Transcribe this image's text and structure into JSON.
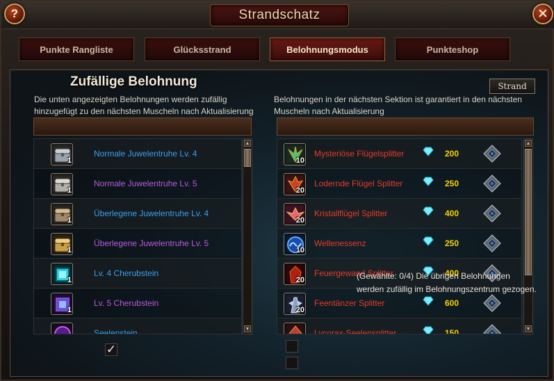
{
  "window": {
    "title": "Strandschatz",
    "help_label": "?",
    "close_label": "✕"
  },
  "tabs": [
    {
      "label": "Punkte Rangliste",
      "active": false
    },
    {
      "label": "Glücksstrand",
      "active": false
    },
    {
      "label": "Belohnungsmodus",
      "active": true
    },
    {
      "label": "Punkteshop",
      "active": false
    }
  ],
  "left_section": {
    "heading": "Zufällige Belohnung",
    "description": "Die unten angezeigten Belohnungen werden zufällig hinzugefügt zu den nächsten Muscheln nach Aktualisierung",
    "items": [
      {
        "name": "Normale Juwelentruhe Lv. 4",
        "qty": "1",
        "icon": "silver-chest-icon",
        "color": "#3aa0f0"
      },
      {
        "name": "Normale Juwelentruhe Lv. 5",
        "qty": "1",
        "icon": "silver-chest-icon",
        "color": "#b85ae0"
      },
      {
        "name": "Überlegene Juwelentruhe Lv. 4",
        "qty": "1",
        "icon": "bronze-chest-icon",
        "color": "#3aa0f0"
      },
      {
        "name": "Überlegene Juwelentruhe Lv. 5",
        "qty": "1",
        "icon": "gold-chest-icon",
        "color": "#b85ae0"
      },
      {
        "name": "Lv. 4 Cherubstein",
        "qty": "1",
        "icon": "cyan-gem-icon",
        "color": "#3aa0f0"
      },
      {
        "name": "Lv. 5 Cherubstein",
        "qty": "1",
        "icon": "purple-gem-icon",
        "color": "#b85ae0"
      },
      {
        "name": "Seelenstein",
        "qty": "",
        "icon": "soulstone-icon",
        "color": "#3aa0f0"
      }
    ]
  },
  "right_section": {
    "button_label": "Strand",
    "description": "Belohnungen in der nächsten Sektion ist garantiert in den nächsten Muscheln nach Aktualisierung",
    "items": [
      {
        "name": "Mysteriöse Flügelsplitter",
        "qty": "10",
        "price": "200",
        "icon": "wing-fragment-green-icon"
      },
      {
        "name": "Lodernde Flügel Splitter",
        "qty": "20",
        "price": "250",
        "icon": "wing-fragment-red-icon"
      },
      {
        "name": "Kristallflügel Splitter",
        "qty": "20",
        "price": "400",
        "icon": "wing-fragment-pink-icon"
      },
      {
        "name": "Wellenessenz",
        "qty": "10",
        "price": "250",
        "icon": "wave-essence-icon"
      },
      {
        "name": "Feuergewand Splitter",
        "qty": "20",
        "price": "400",
        "icon": "fire-robe-fragment-icon"
      },
      {
        "name": "Feentänzer Splitter",
        "qty": "20",
        "price": "600",
        "icon": "fairy-dancer-fragment-icon"
      },
      {
        "name": "Lycorax-Seelensplitter",
        "qty": "",
        "price": "150",
        "icon": "lycorax-fragment-icon"
      }
    ]
  },
  "footer": {
    "note": "(Gewählte: 0/4) Die übrigen Belohnungen werden zufällig im Belohnungszentrum gezogen."
  },
  "colors": {
    "text_blue": "#3aa0f0",
    "text_purple": "#b85ae0",
    "text_red": "#e83a2a",
    "price_yellow": "#f4d400"
  }
}
